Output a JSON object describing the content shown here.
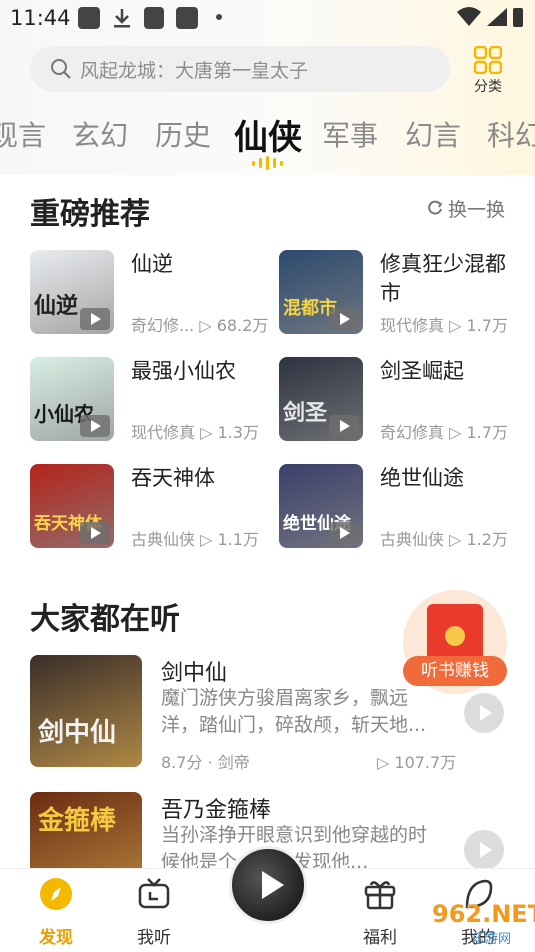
{
  "status_bar": {
    "time": "11:44"
  },
  "search": {
    "placeholder": "风起龙城：大唐第一皇太子"
  },
  "category_button": {
    "label": "分类"
  },
  "channel_tabs": [
    {
      "label": "现言"
    },
    {
      "label": "玄幻"
    },
    {
      "label": "历史"
    },
    {
      "label": "仙侠",
      "active": true
    },
    {
      "label": "军事"
    },
    {
      "label": "幻言"
    },
    {
      "label": "科幻"
    }
  ],
  "recommend": {
    "title": "重磅推荐",
    "refresh_label": "换一换",
    "books": [
      {
        "title": "仙逆",
        "genre": "奇幻修...",
        "plays": "68.2万",
        "cover_text": "仙逆",
        "cover_color": "#e9ecef"
      },
      {
        "title": "修真狂少混都市",
        "genre": "现代修真",
        "plays": "1.7万",
        "cover_text": "混都市",
        "cover_color": "#2c4a6e"
      },
      {
        "title": "最强小仙农",
        "genre": "现代修真",
        "plays": "1.3万",
        "cover_text": "小仙农",
        "cover_color": "#d8efe4"
      },
      {
        "title": "剑圣崛起",
        "genre": "奇幻修真",
        "plays": "1.7万",
        "cover_text": "剑圣",
        "cover_color": "#2d3340"
      },
      {
        "title": "吞天神体",
        "genre": "古典仙侠",
        "plays": "1.1万",
        "cover_text": "吞天神体",
        "cover_color": "#b3241c"
      },
      {
        "title": "绝世仙途",
        "genre": "古典仙侠",
        "plays": "1.2万",
        "cover_text": "绝世仙途",
        "cover_color": "#3b3f6a"
      }
    ]
  },
  "listening": {
    "title": "大家都在听",
    "items": [
      {
        "title": "剑中仙",
        "description": "魔门游侠方骏眉离家乡，飘远洋，踏仙门，碎敌颅，斩天地...",
        "meta": "8.7分 · 剑帝",
        "plays": "107.7万",
        "cover_text": "剑中仙",
        "cover_color": "#3a2e2a"
      },
      {
        "title": "吾乃金箍棒",
        "description": "当孙泽挣开眼意识到他穿越的时候他是个...当他发现他...",
        "meta": "",
        "plays": "",
        "cover_text": "金箍棒",
        "cover_color": "#6a2c12"
      }
    ]
  },
  "red_envelope": {
    "label": "听书赚钱"
  },
  "bottom_nav": [
    {
      "label": "发现",
      "icon": "compass-icon",
      "active": true
    },
    {
      "label": "我听",
      "icon": "tv-icon"
    },
    {
      "label": "福利",
      "icon": "gift-icon"
    },
    {
      "label": "我的",
      "icon": "user-icon"
    }
  ],
  "watermark": {
    "text": "962.NET",
    "sub": "乐游网"
  },
  "colors": {
    "accent": "#f5b800",
    "active_nav": "#e8a100",
    "envelope": "#ea3a2c"
  }
}
